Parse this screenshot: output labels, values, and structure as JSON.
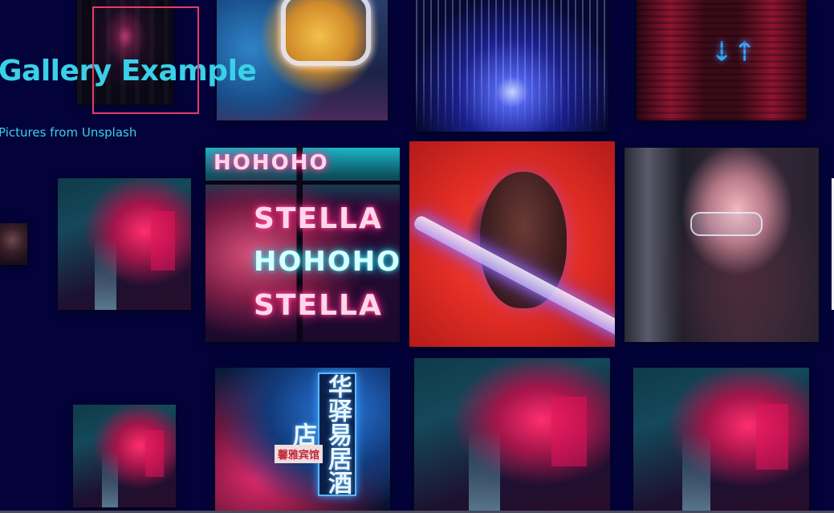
{
  "header": {
    "title": "Gallery Example",
    "subtitle": "Pictures from Unsplash"
  },
  "gallery": {
    "tiles": [
      {
        "name": "photo-neon-tunnel",
        "subject": "neon tunnel corridor"
      },
      {
        "name": "photo-neon-sign",
        "subject": "neon sign"
      },
      {
        "name": "photo-light-rays",
        "subject": "blue light streaks"
      },
      {
        "name": "photo-neon-stairs",
        "subject": "red stairs with arrow sign"
      },
      {
        "name": "photo-neon-alley-1",
        "subject": "neon alley"
      },
      {
        "name": "photo-portrait-small",
        "subject": "portrait"
      },
      {
        "name": "photo-stella-neon",
        "subject": "STELLA neon window"
      },
      {
        "name": "photo-neon-portrait",
        "subject": "portrait with neon light tube"
      },
      {
        "name": "photo-glasses-portrait",
        "subject": "portrait with glasses"
      },
      {
        "name": "photo-neon-alley-2",
        "subject": "neon alley"
      },
      {
        "name": "photo-chinese-sign",
        "subject": "chinese neon signs"
      },
      {
        "name": "photo-neon-alley-3",
        "subject": "neon alley"
      },
      {
        "name": "photo-neon-alley-4",
        "subject": "neon alley"
      }
    ],
    "stella_text": [
      "HOHOHO",
      "STELLA",
      "HOHOHO",
      "STELLA"
    ],
    "chinese_vertical_text": "华驿易居酒店",
    "chinese_horizontal_text": "馨雅宾馆",
    "arrow_glyphs": "↓↑"
  },
  "colors": {
    "background": "#03033a",
    "title": "#3ad0e8",
    "focus_frame": "#e83a6a"
  }
}
